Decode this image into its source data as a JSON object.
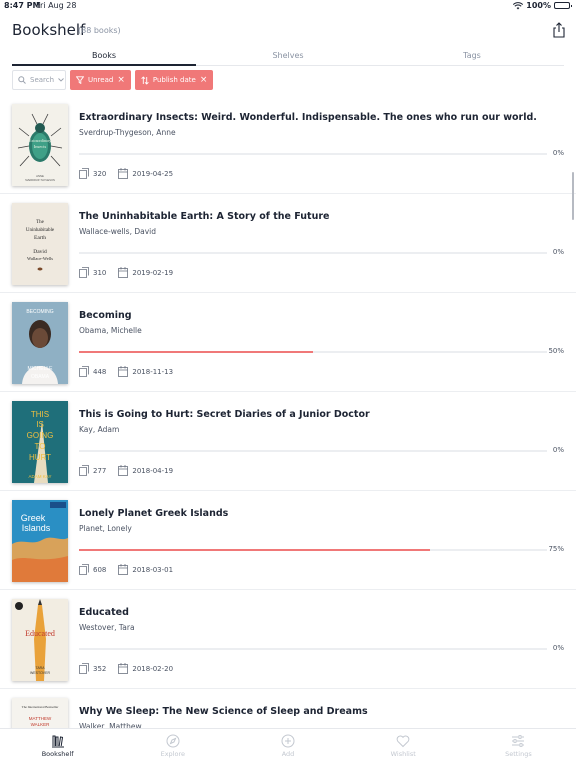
{
  "status": {
    "time": "8:47 PM",
    "date": "Fri Aug 28",
    "battery": "100%"
  },
  "header": {
    "title": "Bookshelf",
    "count": "(88 books)"
  },
  "tabs": [
    {
      "label": "Books",
      "active": true
    },
    {
      "label": "Shelves",
      "active": false
    },
    {
      "label": "Tags",
      "active": false
    }
  ],
  "filters": {
    "search_placeholder": "Search",
    "chips": [
      {
        "label": "Unread",
        "icon": "filter-icon"
      },
      {
        "label": "Publish date",
        "icon": "sort-icon"
      }
    ]
  },
  "books": [
    {
      "title": "Extraordinary Insects: Weird. Wonderful. Indispensable. The ones who run our world.",
      "author": "Sverdrup-Thygeson, Anne",
      "pages": "320",
      "date": "2019-04-25",
      "progress_label": "0%",
      "progress": 0,
      "cover_color": "#f3f1ea"
    },
    {
      "title": "The Uninhabitable Earth: A Story of the Future",
      "author": "Wallace-wells, David",
      "pages": "310",
      "date": "2019-02-19",
      "progress_label": "0%",
      "progress": 0,
      "cover_color": "#efe9df"
    },
    {
      "title": "Becoming",
      "author": "Obama, Michelle",
      "pages": "448",
      "date": "2018-11-13",
      "progress_label": "50%",
      "progress": 0.5,
      "cover_color": "#8fb0c4"
    },
    {
      "title": "This is Going to Hurt: Secret Diaries of a Junior Doctor",
      "author": "Kay, Adam",
      "pages": "277",
      "date": "2018-04-19",
      "progress_label": "0%",
      "progress": 0,
      "cover_color": "#1f6f7a"
    },
    {
      "title": "Lonely Planet Greek Islands",
      "author": "Planet, Lonely",
      "pages": "608",
      "date": "2018-03-01",
      "progress_label": "75%",
      "progress": 0.75,
      "cover_color": "#2a8fc4"
    },
    {
      "title": "Educated",
      "author": "Westover, Tara",
      "pages": "352",
      "date": "2018-02-20",
      "progress_label": "0%",
      "progress": 0,
      "cover_color": "#f2ede2"
    },
    {
      "title": "Why We Sleep: The New Science of Sleep and Dreams",
      "author": "Walker, Matthew",
      "pages": "",
      "date": "",
      "progress_label": "",
      "progress": 0,
      "cover_color": "#f5f3ee"
    }
  ],
  "cover_text": {
    "insects": [
      "Extraordinary",
      "Insects",
      "ANNE",
      "SVERDRUP-THYGESON"
    ],
    "earth": [
      "The",
      "Uninhabitable",
      "Earth",
      "David",
      "Wallace-Wells"
    ],
    "becoming": [
      "BECOMING",
      "MICHELLE",
      "OBAMA"
    ],
    "hurt": [
      "THIS",
      "IS",
      "GOING",
      "TO",
      "HURT",
      "ADAM KAY"
    ],
    "greek": [
      "Greek",
      "Islands"
    ],
    "educated": [
      "Educated",
      "TARA",
      "WESTOVER"
    ],
    "sleep": [
      "The International Bestseller",
      "MATTHEW",
      "WALKER"
    ]
  },
  "bottom_nav": [
    {
      "label": "Bookshelf",
      "icon": "bookshelf-icon",
      "active": true
    },
    {
      "label": "Explore",
      "icon": "compass-icon",
      "active": false
    },
    {
      "label": "Add",
      "icon": "add-circle-icon",
      "active": false
    },
    {
      "label": "Wishlist",
      "icon": "heart-icon",
      "active": false
    },
    {
      "label": "Settings",
      "icon": "sliders-icon",
      "active": false
    }
  ],
  "colors": {
    "accent": "#f07878",
    "text": "#1d2433",
    "muted": "#8a93a3"
  }
}
